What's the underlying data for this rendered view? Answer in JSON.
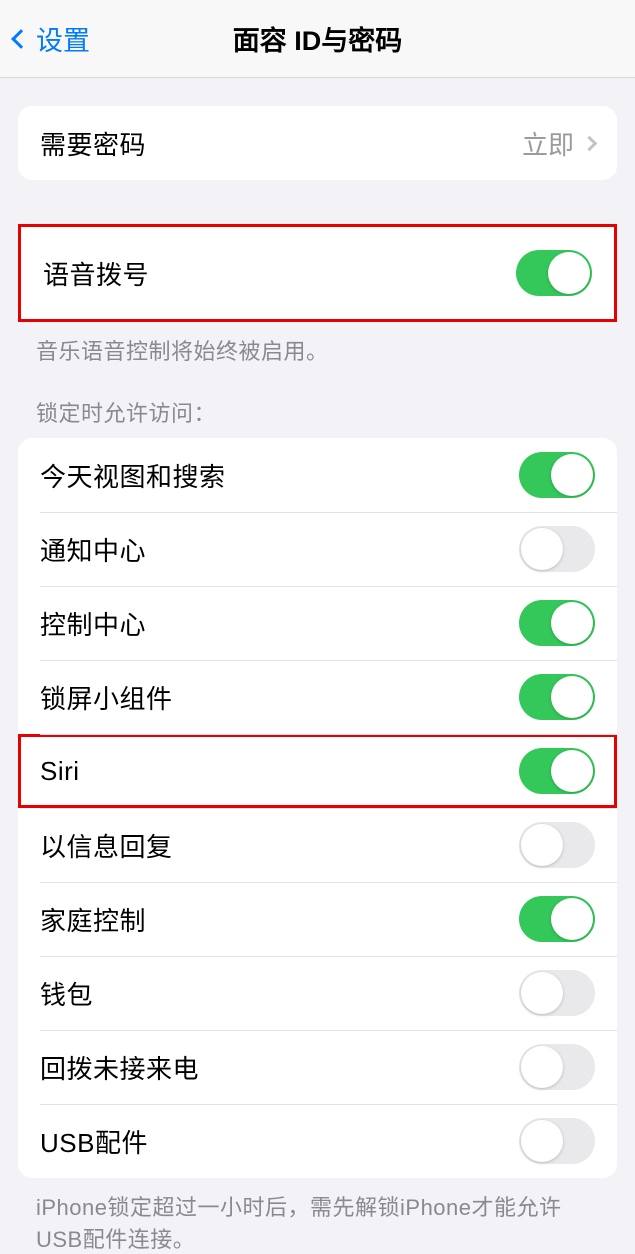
{
  "nav": {
    "back_label": "设置",
    "title": "面容 ID与密码"
  },
  "passcode_group": {
    "require_passcode": {
      "label": "需要密码",
      "value": "立即"
    }
  },
  "voice_dial": {
    "label": "语音拨号",
    "on": true,
    "footnote": "音乐语音控制将始终被启用。"
  },
  "locked_access": {
    "header": "锁定时允许访问：",
    "items": [
      {
        "label": "今天视图和搜索",
        "on": true,
        "highlight": false
      },
      {
        "label": "通知中心",
        "on": false,
        "highlight": false
      },
      {
        "label": "控制中心",
        "on": true,
        "highlight": false
      },
      {
        "label": "锁屏小组件",
        "on": true,
        "highlight": false
      },
      {
        "label": "Siri",
        "on": true,
        "highlight": true
      },
      {
        "label": "以信息回复",
        "on": false,
        "highlight": false
      },
      {
        "label": "家庭控制",
        "on": true,
        "highlight": false
      },
      {
        "label": "钱包",
        "on": false,
        "highlight": false
      },
      {
        "label": "回拨未接来电",
        "on": false,
        "highlight": false
      },
      {
        "label": "USB配件",
        "on": false,
        "highlight": false
      }
    ],
    "footnote": "iPhone锁定超过一小时后，需先解锁iPhone才能允许USB配件连接。"
  }
}
